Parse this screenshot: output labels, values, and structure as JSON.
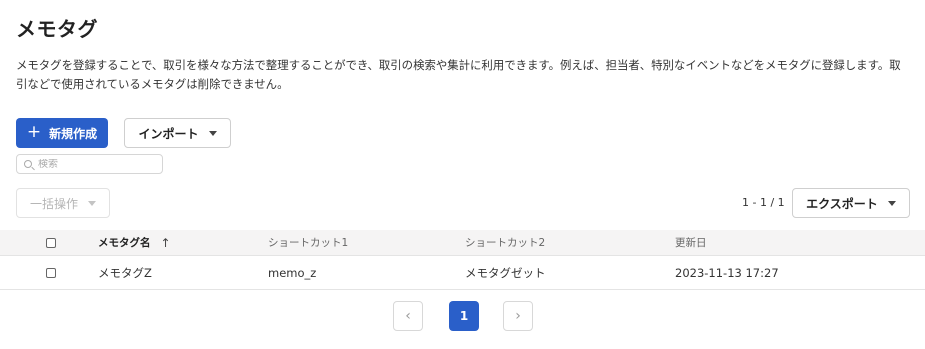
{
  "page": {
    "title": "メモタグ",
    "description": "メモタグを登録することで、取引を様々な方法で整理することができ、取引の検索や集計に利用できます。例えば、担当者、特別なイベントなどをメモタグに登録します。取引などで使用されているメモタグは削除できません。"
  },
  "toolbar": {
    "new_label": "新規作成",
    "import_label": "インポート",
    "bulk_label": "一括操作",
    "export_label": "エクスポート",
    "count": "1 - 1 / 1"
  },
  "search": {
    "placeholder": "検索",
    "value": ""
  },
  "table": {
    "headers": [
      "メモタグ名",
      "ショートカット1",
      "ショートカット2",
      "更新日"
    ],
    "sort_indicator": "↑",
    "rows": [
      [
        "メモタグZ",
        "memo_z",
        "メモタグゼット",
        "2023-11-13 17:27"
      ]
    ]
  },
  "pagination": {
    "prev": "‹",
    "current": "1",
    "next": "›"
  },
  "colors": {
    "accent": "#2a5fc9",
    "header_bg": "#f5f4f4"
  }
}
